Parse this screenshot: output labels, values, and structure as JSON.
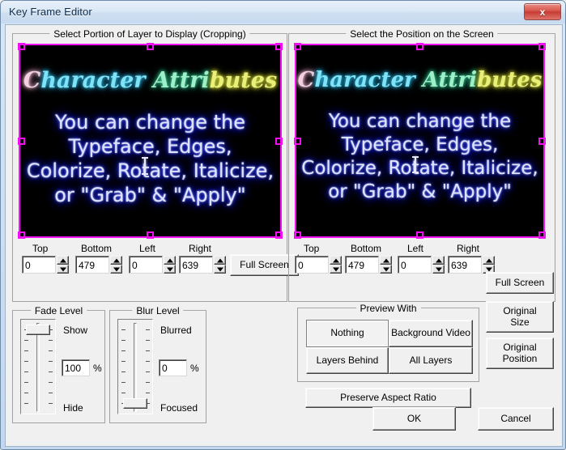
{
  "window": {
    "title": "Key Frame Editor",
    "close_label": "x",
    "accent_crop": "#f20ff2",
    "titlebar_color": "#cfdff1",
    "close_color": "#c63c33"
  },
  "crop_panel": {
    "legend": "Select Portion of Layer to Display (Cropping)",
    "fields": [
      {
        "label": "Top",
        "value": "0"
      },
      {
        "label": "Bottom",
        "value": "479"
      },
      {
        "label": "Left",
        "value": "0"
      },
      {
        "label": "Right",
        "value": "639"
      }
    ],
    "full_screen_label": "Full Screen"
  },
  "position_panel": {
    "legend": "Select the Position on the Screen",
    "fields": [
      {
        "label": "Top",
        "value": "0"
      },
      {
        "label": "Bottom",
        "value": "479"
      },
      {
        "label": "Left",
        "value": "0"
      },
      {
        "label": "Right",
        "value": "639"
      }
    ],
    "full_screen_label": "Full Screen"
  },
  "video_preview": {
    "title_parts": [
      "C",
      "haracter",
      " Attri",
      "butes"
    ],
    "lines": [
      "You can change the",
      "Typeface, Edges,",
      "Colorize, Rotate, Italicize,",
      "or \"Grab\" & \"Apply\""
    ],
    "background": "#000000"
  },
  "fade_level": {
    "legend": "Fade Level",
    "top_label": "Show",
    "bottom_label": "Hide",
    "value": "100",
    "unit": "%",
    "thumb_position": "top"
  },
  "blur_level": {
    "legend": "Blur Level",
    "top_label": "Blurred",
    "bottom_label": "Focused",
    "value": "0",
    "unit": "%",
    "thumb_position": "bottom"
  },
  "preview_with": {
    "legend": "Preview With",
    "options": [
      {
        "label": "Nothing",
        "selected": true
      },
      {
        "label": "Background Video",
        "selected": false
      },
      {
        "label": "Layers Behind",
        "selected": false
      },
      {
        "label": "All Layers",
        "selected": false
      }
    ],
    "preserve_aspect_label": "Preserve Aspect Ratio"
  },
  "side_buttons": {
    "full_screen": "Full Screen",
    "original_size": "Original\nSize",
    "original_size_l1": "Original",
    "original_size_l2": "Size",
    "original_position_l1": "Original",
    "original_position_l2": "Position"
  },
  "dialog_buttons": {
    "ok": "OK",
    "cancel": "Cancel"
  }
}
